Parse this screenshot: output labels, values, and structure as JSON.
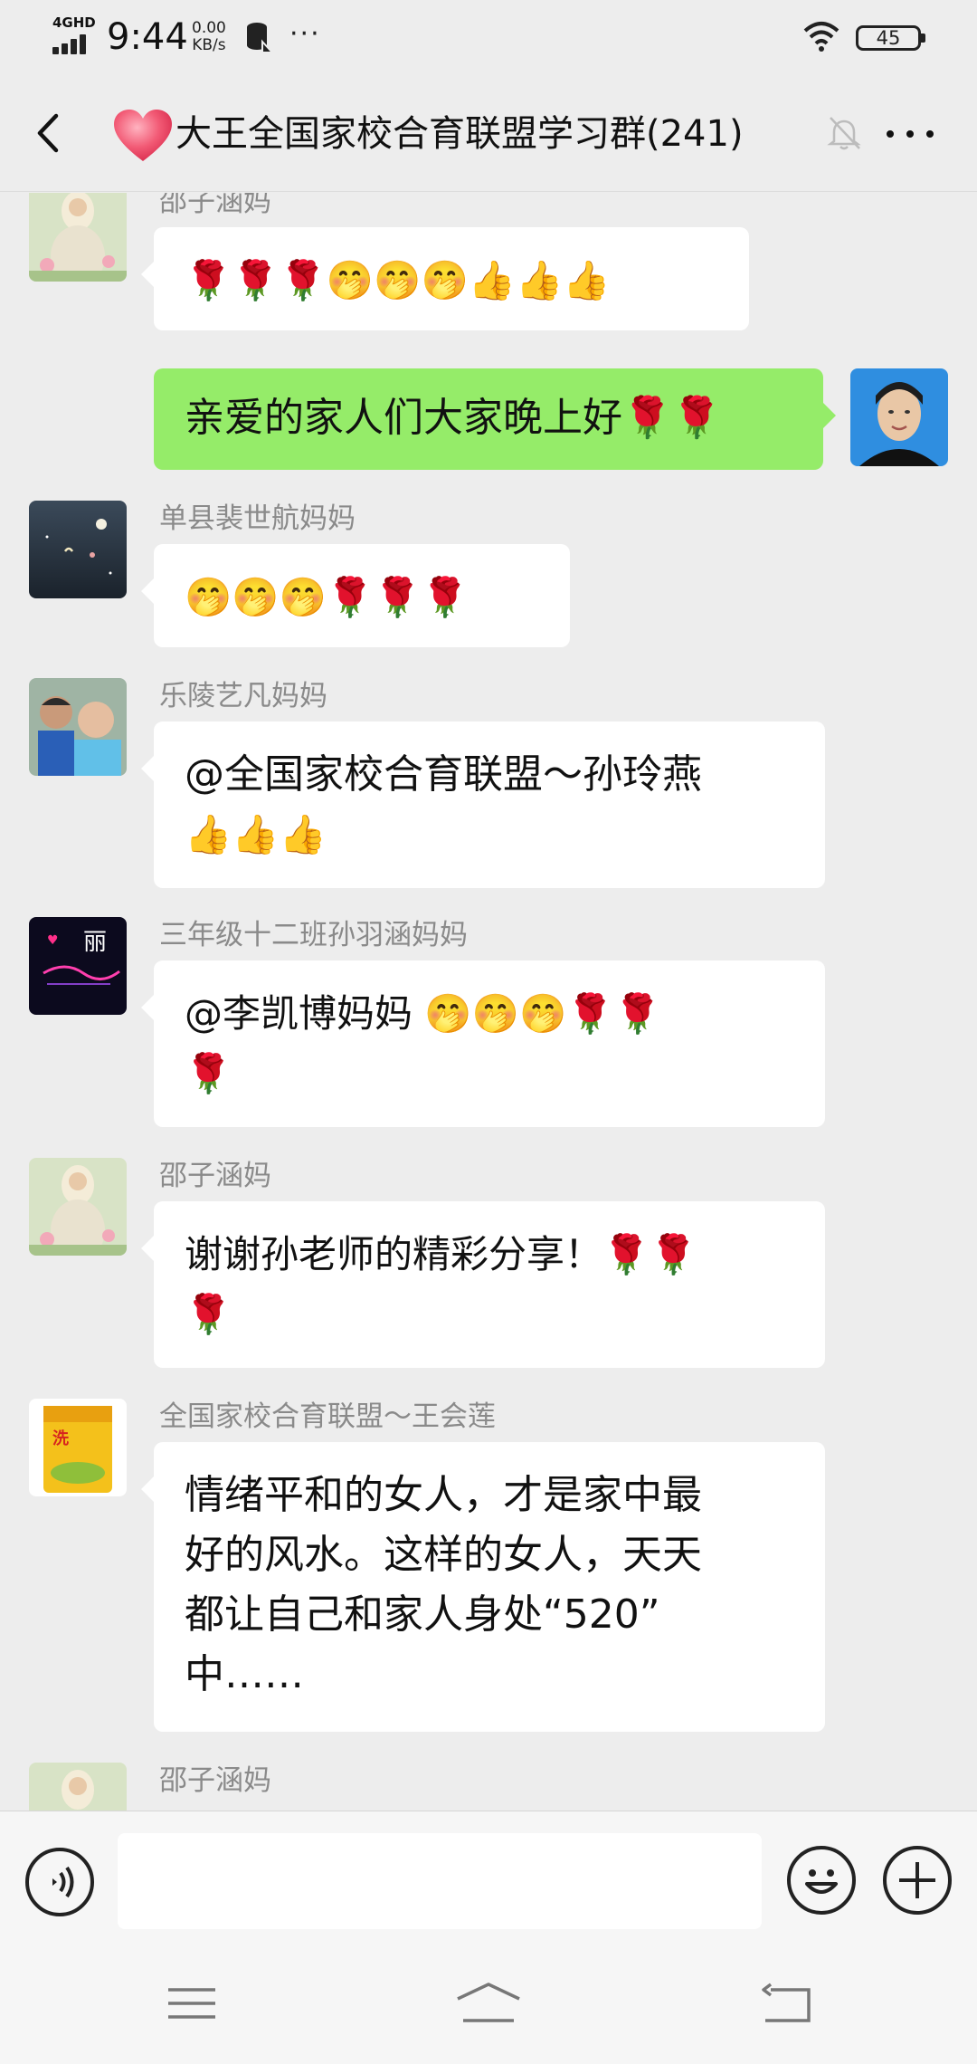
{
  "status": {
    "network": "4GHD",
    "time": "9:44",
    "speed_value": "0.00",
    "speed_unit": "KB/s",
    "more": "···",
    "battery": "45"
  },
  "header": {
    "back_icon": "chevron-left-icon",
    "title": "大王全国家校合育联盟学习群(241)",
    "mute_icon": "bell-muted-icon",
    "menu_icon": "more-horizontal-icon"
  },
  "messages": [
    {
      "sender": "邵子涵妈",
      "text": "🌹🌹🌹🤭🤭🤭👍👍👍",
      "side": "left"
    },
    {
      "sender": "",
      "text": "亲爱的家人们大家晚上好🌹🌹",
      "side": "right"
    },
    {
      "sender": "单县裴世航妈妈",
      "text": "🤭🤭🤭🌹🌹🌹",
      "side": "left"
    },
    {
      "sender": "乐陵艺凡妈妈",
      "line1": "@全国家校合育联盟～孙玲燕",
      "line2": "👍👍👍",
      "side": "left"
    },
    {
      "sender": "三年级十二班孙羽涵妈妈",
      "line1": "@李凯博妈妈  🤭🤭🤭🌹🌹",
      "line2": "🌹",
      "side": "left"
    },
    {
      "sender": "邵子涵妈",
      "line1": "谢谢孙老师的精彩分享！🌹🌹",
      "line2": "🌹",
      "side": "left"
    },
    {
      "sender": "全国家校合育联盟～王会莲",
      "line1": "情绪平和的女人，才是家中最",
      "line2": "好的风水。这样的女人，天天",
      "line3": "都让自己和家人身处“520”",
      "line4": "中……",
      "side": "left"
    },
    {
      "sender": "邵子涵妈",
      "side": "left"
    }
  ],
  "avatar3_text": "丽",
  "input": {
    "placeholder": "",
    "voice_icon": "voice-icon",
    "emoji_icon": "emoji-icon",
    "plus_icon": "plus-icon"
  },
  "nav": {
    "menu_icon": "menu-icon",
    "home_icon": "home-icon",
    "back_icon": "back-icon"
  },
  "colors": {
    "background": "#ededed",
    "bubble_self": "#95ec69",
    "bubble_other": "#ffffff",
    "sender_name": "#8a8a8a"
  }
}
